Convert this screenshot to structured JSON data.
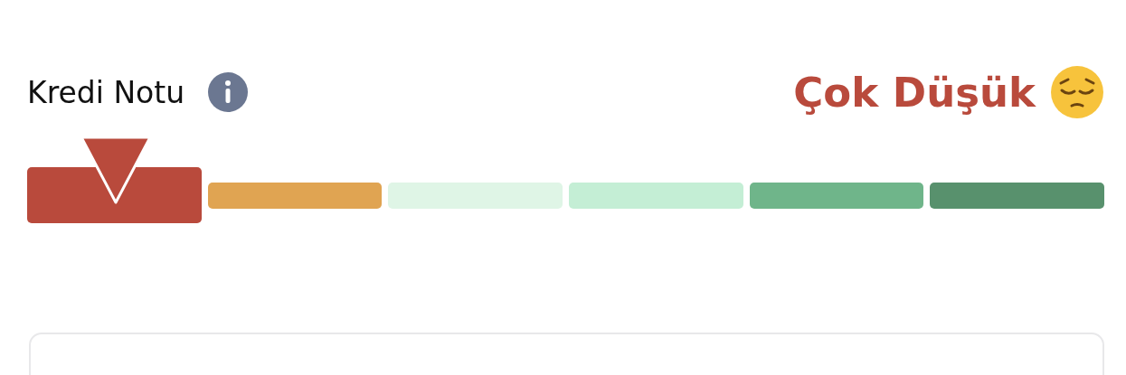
{
  "header": {
    "label": "Kredi Notu",
    "rating": "Çok Düşük"
  },
  "segments": [
    {
      "color": "#b94a3c",
      "selected": true
    },
    {
      "color": "#e0a452",
      "selected": false
    },
    {
      "color": "#dff5e6",
      "selected": false
    },
    {
      "color": "#c4eed5",
      "selected": false
    },
    {
      "color": "#6fb58a",
      "selected": false
    },
    {
      "color": "#58916d",
      "selected": false
    }
  ]
}
